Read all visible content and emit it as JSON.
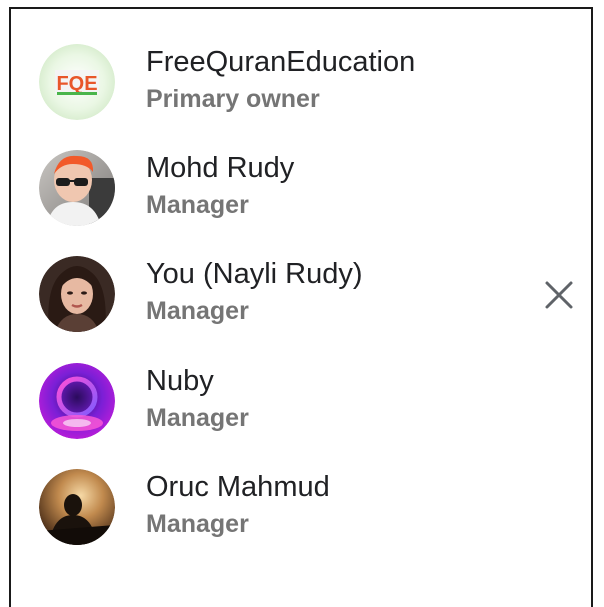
{
  "members": [
    {
      "name": "FreeQuranEducation",
      "role": "Primary owner",
      "avatar_icon": "fqe-logo-icon",
      "avatar_text": "FQE",
      "removable": false
    },
    {
      "name": "Mohd Rudy",
      "role": "Manager",
      "avatar_icon": "person-with-sunglasses-avatar",
      "removable": false
    },
    {
      "name": "You (Nayli Rudy)",
      "role": "Manager",
      "avatar_icon": "woman-portrait-avatar",
      "removable": true,
      "remove_icon": "close-icon"
    },
    {
      "name": "Nuby",
      "role": "Manager",
      "avatar_icon": "neon-ring-avatar",
      "removable": false
    },
    {
      "name": "Oruc Mahmud",
      "role": "Manager",
      "avatar_icon": "silhouette-sunset-avatar",
      "removable": false
    }
  ],
  "colors": {
    "name_text": "#202124",
    "role_text": "#757575",
    "close_icon": "#5f6368"
  }
}
